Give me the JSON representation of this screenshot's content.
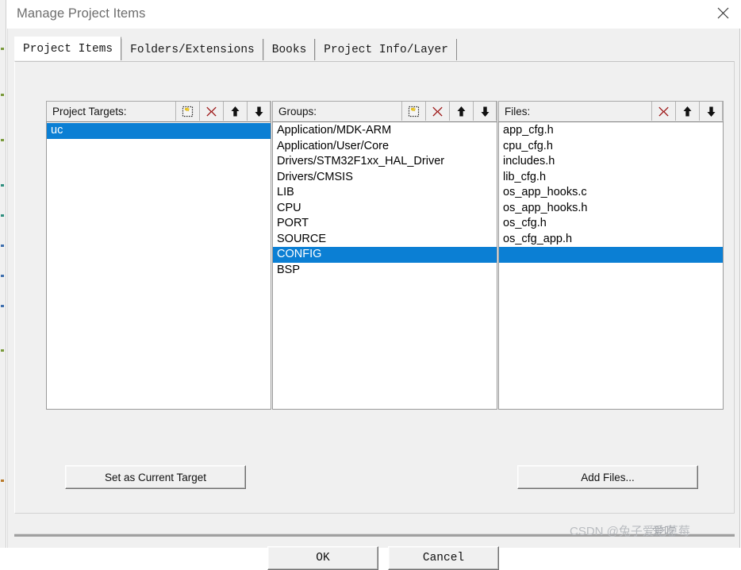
{
  "window": {
    "title": "Manage Project Items",
    "close_icon": "close-icon"
  },
  "tabs": [
    {
      "label": "Project Items",
      "active": true
    },
    {
      "label": "Folders/Extensions",
      "active": false
    },
    {
      "label": "Books",
      "active": false
    },
    {
      "label": "Project Info/Layer",
      "active": false
    }
  ],
  "panes": {
    "targets": {
      "label": "Project Targets:",
      "icons": [
        {
          "name": "new-item-icon",
          "title": "New (Insert)"
        },
        {
          "name": "delete-icon",
          "title": "Remove Item"
        },
        {
          "name": "move-up-icon",
          "title": "Move Up"
        },
        {
          "name": "move-down-icon",
          "title": "Move Down"
        }
      ],
      "items": [
        {
          "label": "uc",
          "selected": true
        }
      ]
    },
    "groups": {
      "label": "Groups:",
      "icons": [
        {
          "name": "new-item-icon",
          "title": "New (Insert)"
        },
        {
          "name": "delete-icon",
          "title": "Remove Item"
        },
        {
          "name": "move-up-icon",
          "title": "Move Up"
        },
        {
          "name": "move-down-icon",
          "title": "Move Down"
        }
      ],
      "items": [
        {
          "label": "Application/MDK-ARM",
          "selected": false
        },
        {
          "label": "Application/User/Core",
          "selected": false
        },
        {
          "label": "Drivers/STM32F1xx_HAL_Driver",
          "selected": false
        },
        {
          "label": "Drivers/CMSIS",
          "selected": false
        },
        {
          "label": "LIB",
          "selected": false
        },
        {
          "label": "CPU",
          "selected": false
        },
        {
          "label": "PORT",
          "selected": false
        },
        {
          "label": "SOURCE",
          "selected": false
        },
        {
          "label": "CONFIG",
          "selected": true
        },
        {
          "label": "BSP",
          "selected": false
        }
      ]
    },
    "files": {
      "label": "Files:",
      "icons": [
        {
          "name": "delete-icon",
          "title": "Remove Item"
        },
        {
          "name": "move-up-icon",
          "title": "Move Up"
        },
        {
          "name": "move-down-icon",
          "title": "Move Down"
        }
      ],
      "items": [
        {
          "label": "app_cfg.h",
          "selected": false
        },
        {
          "label": "cpu_cfg.h",
          "selected": false
        },
        {
          "label": "includes.h",
          "selected": false
        },
        {
          "label": "lib_cfg.h",
          "selected": false
        },
        {
          "label": "os_app_hooks.c",
          "selected": false
        },
        {
          "label": "os_app_hooks.h",
          "selected": false
        },
        {
          "label": "os_cfg.h",
          "selected": false
        },
        {
          "label": "os_cfg_app.h",
          "selected": false
        },
        {
          "label": "",
          "selected": true
        }
      ]
    }
  },
  "buttons": {
    "set_as_current_target": "Set as Current Target",
    "add_files": "Add Files...",
    "ok": "OK",
    "cancel": "Cancel"
  },
  "watermark": {
    "prefix": "CSDN @兔子",
    "overlap_back": "爱吃",
    "overlap_front": "爱吃",
    "suffix": "草莓"
  },
  "colors": {
    "selection_blue": "#0b7fd4",
    "dialog_face": "#f0f0f0",
    "title_text": "#6d6d6d",
    "delete_red": "#9c1414",
    "list_background": "#ffffff"
  }
}
